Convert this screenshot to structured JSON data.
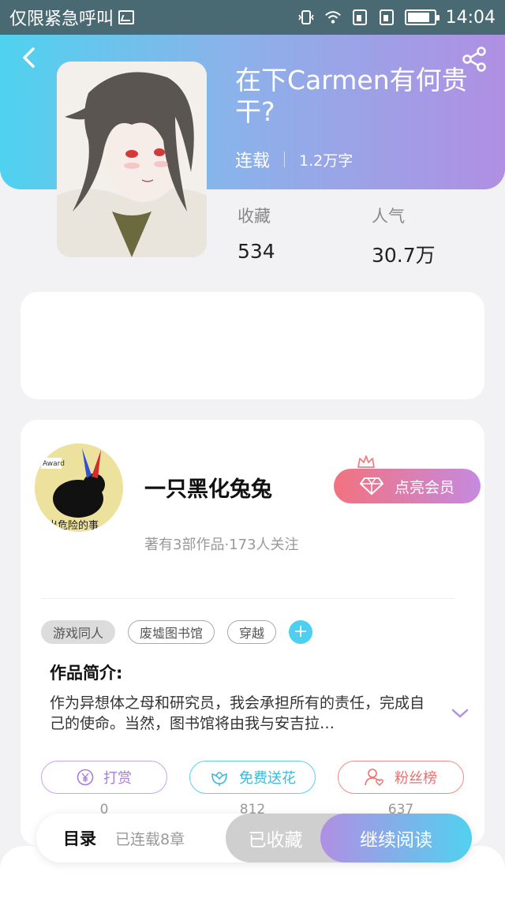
{
  "status_bar": {
    "carrier": "仅限紧急呼叫",
    "time": "14:04",
    "battery_level": 0.85
  },
  "book": {
    "title": "在下Carmen有何贵干?",
    "status": "连载",
    "word_count": "1.2万字",
    "stats": [
      {
        "label": "收藏",
        "value": "534"
      },
      {
        "label": "人气",
        "value": "30.7万"
      }
    ]
  },
  "author": {
    "name": "一只黑化兔兔",
    "info": "著有3部作品·173人关注",
    "avatar_text": "出危险的事",
    "vip_label": "点亮会员"
  },
  "tags": [
    "游戏同人",
    "废墟图书馆",
    "穿越"
  ],
  "tag_add": "+",
  "intro": {
    "label": "作品简介:",
    "text": "作为异想体之母和研究员，我会承担所有的责任，完成自己的使命。当然，图书馆将由我与安吉拉…"
  },
  "actions": [
    {
      "label": "打赏",
      "count": "0",
      "icon": "yen-coin-icon",
      "color": "#a77dd9"
    },
    {
      "label": "免费送花",
      "count": "812",
      "icon": "flower-icon",
      "color": "#3cbad8"
    },
    {
      "label": "粉丝榜",
      "count": "637",
      "icon": "user-heart-icon",
      "color": "#ea7070"
    }
  ],
  "bottom": {
    "toc_label": "目录",
    "chapters": "已连载8章",
    "collected_label": "已收藏",
    "continue_label": "继续阅读"
  },
  "colors": {
    "header_gradient": [
      "#4fd2ef",
      "#b08fe3"
    ],
    "vip_gradient": [
      "#f2727f",
      "#c58adf"
    ]
  }
}
